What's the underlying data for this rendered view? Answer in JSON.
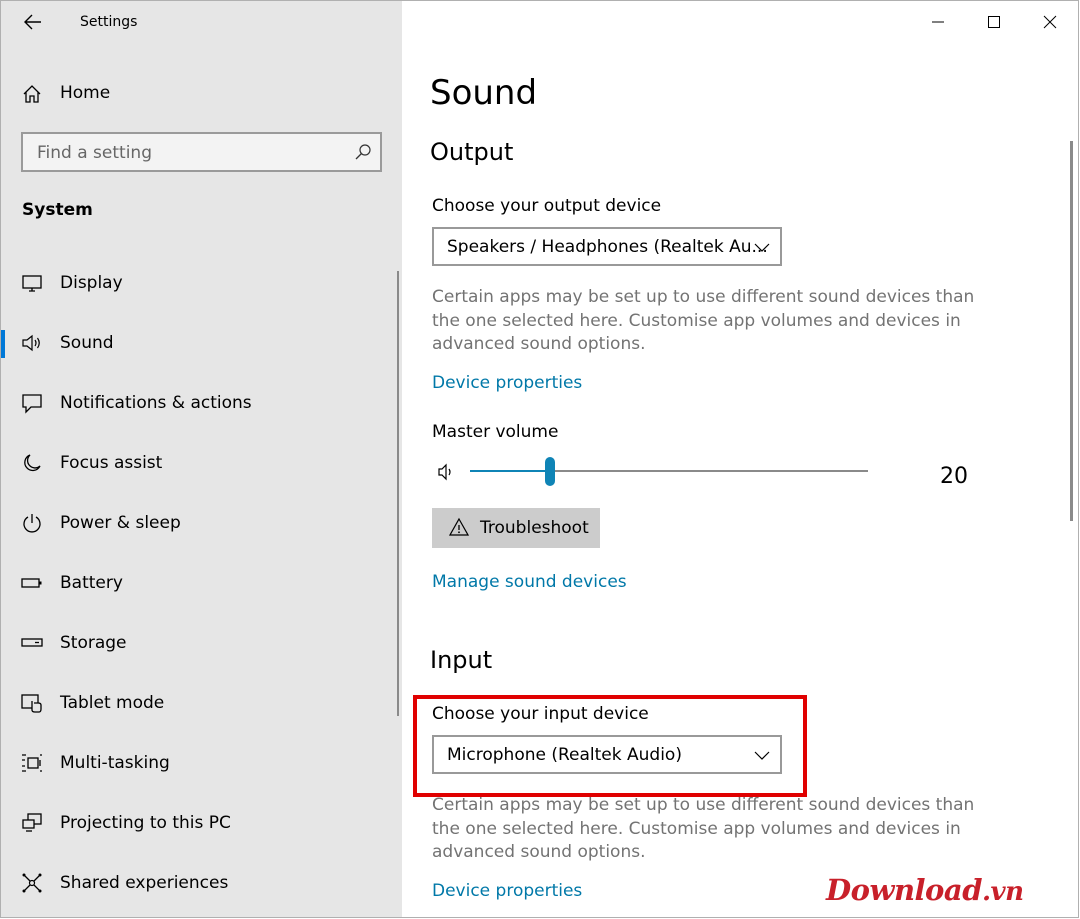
{
  "window": {
    "title": "Settings"
  },
  "sidebar": {
    "home_label": "Home",
    "search_placeholder": "Find a setting",
    "section_title": "System",
    "items": [
      {
        "label": "Display",
        "icon": "monitor-icon"
      },
      {
        "label": "Sound",
        "icon": "speaker-icon",
        "active": true
      },
      {
        "label": "Notifications & actions",
        "icon": "notification-icon"
      },
      {
        "label": "Focus assist",
        "icon": "moon-icon"
      },
      {
        "label": "Power & sleep",
        "icon": "power-icon"
      },
      {
        "label": "Battery",
        "icon": "battery-icon"
      },
      {
        "label": "Storage",
        "icon": "storage-icon"
      },
      {
        "label": "Tablet mode",
        "icon": "tablet-mode-icon"
      },
      {
        "label": "Multi-tasking",
        "icon": "multitasking-icon"
      },
      {
        "label": "Projecting to this PC",
        "icon": "projecting-icon"
      },
      {
        "label": "Shared experiences",
        "icon": "shared-experiences-icon"
      }
    ]
  },
  "main": {
    "page_title": "Sound",
    "output": {
      "heading": "Output",
      "choose_label": "Choose your output device",
      "device_value": "Speakers / Headphones (Realtek Au...",
      "description": "Certain apps may be set up to use different sound devices than the one selected here. Customise app volumes and devices in advanced sound options.",
      "device_properties_link": "Device properties",
      "master_volume_label": "Master volume",
      "volume_value": "20",
      "troubleshoot_label": "Troubleshoot",
      "manage_link": "Manage sound devices"
    },
    "input": {
      "heading": "Input",
      "choose_label": "Choose your input device",
      "device_value": "Microphone (Realtek Audio)",
      "description": "Certain apps may be set up to use different sound devices than the one selected here. Customise app volumes and devices in advanced sound options.",
      "device_properties_link": "Device properties"
    }
  },
  "colors": {
    "accent": "#0078d7",
    "link": "#0078a8",
    "highlight": "#e00000",
    "sidebar_bg": "#e6e6e6"
  },
  "watermark": {
    "main": "Download",
    "tld": ".vn"
  }
}
